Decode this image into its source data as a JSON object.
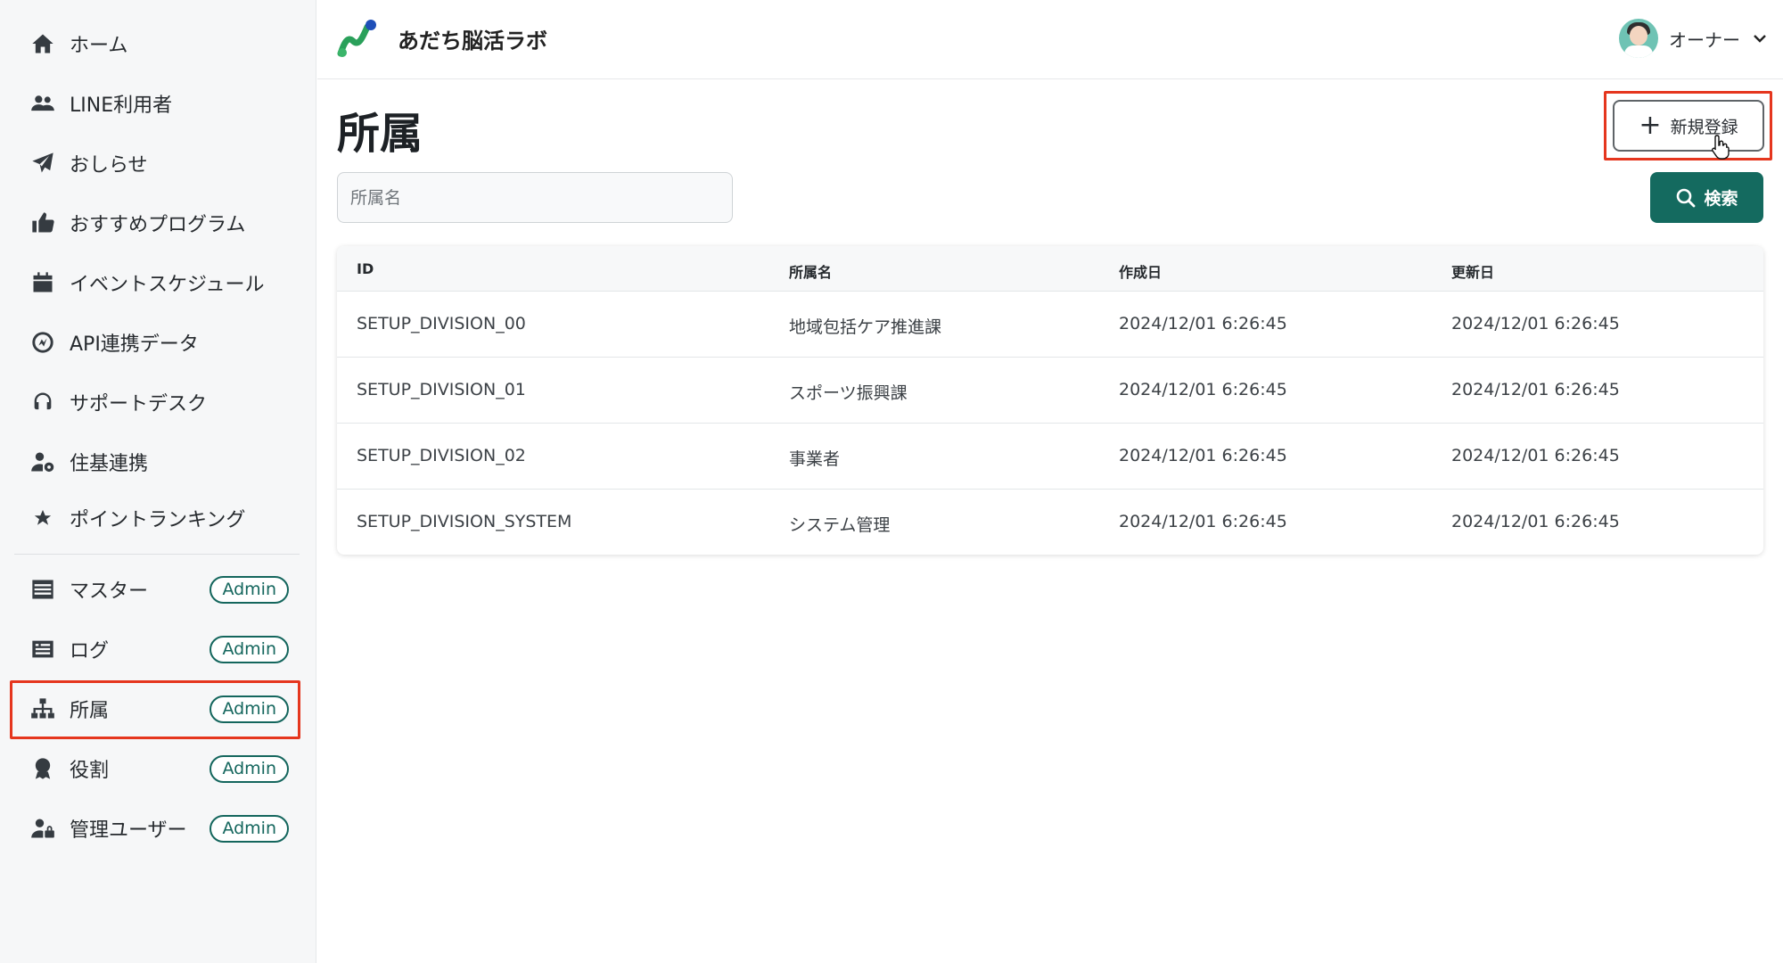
{
  "app": {
    "brand": "あだち脳活ラボ"
  },
  "header": {
    "user_name": "オーナー"
  },
  "sidebar": {
    "items": [
      {
        "label": "ホーム",
        "icon": "home-icon"
      },
      {
        "label": "LINE利用者",
        "icon": "users-icon"
      },
      {
        "label": "おしらせ",
        "icon": "paper-plane-icon"
      },
      {
        "label": "おすすめプログラム",
        "icon": "thumbs-up-icon"
      },
      {
        "label": "イベントスケジュール",
        "icon": "calendar-icon"
      },
      {
        "label": "API連携データ",
        "icon": "api-icon"
      },
      {
        "label": "サポートデスク",
        "icon": "headset-icon"
      },
      {
        "label": "住基連携",
        "icon": "user-gear-icon"
      },
      {
        "label": "ポイントランキング",
        "icon": "star-icon"
      }
    ],
    "admin_items": [
      {
        "label": "マスター",
        "badge": "Admin",
        "icon": "list-icon"
      },
      {
        "label": "ログ",
        "badge": "Admin",
        "icon": "log-icon"
      },
      {
        "label": "所属",
        "badge": "Admin",
        "icon": "sitemap-icon",
        "active": true
      },
      {
        "label": "役割",
        "badge": "Admin",
        "icon": "award-icon"
      },
      {
        "label": "管理ユーザー",
        "badge": "Admin",
        "icon": "user-lock-icon"
      }
    ]
  },
  "main": {
    "title": "所属",
    "new_button_label": "新規登録",
    "search": {
      "placeholder": "所属名",
      "value": "",
      "button_label": "検索"
    },
    "table": {
      "columns": [
        "ID",
        "所属名",
        "作成日",
        "更新日"
      ],
      "rows": [
        [
          "SETUP_DIVISION_00",
          "地域包括ケア推進課",
          "2024/12/01 6:26:45",
          "2024/12/01 6:26:45"
        ],
        [
          "SETUP_DIVISION_01",
          "スポーツ振興課",
          "2024/12/01 6:26:45",
          "2024/12/01 6:26:45"
        ],
        [
          "SETUP_DIVISION_02",
          "事業者",
          "2024/12/01 6:26:45",
          "2024/12/01 6:26:45"
        ],
        [
          "SETUP_DIVISION_SYSTEM",
          "システム管理",
          "2024/12/01 6:26:45",
          "2024/12/01 6:26:45"
        ]
      ]
    }
  },
  "colors": {
    "accent": "#146a5f",
    "highlight": "#e5361e",
    "sidebar_bg": "#f6f7f8"
  }
}
